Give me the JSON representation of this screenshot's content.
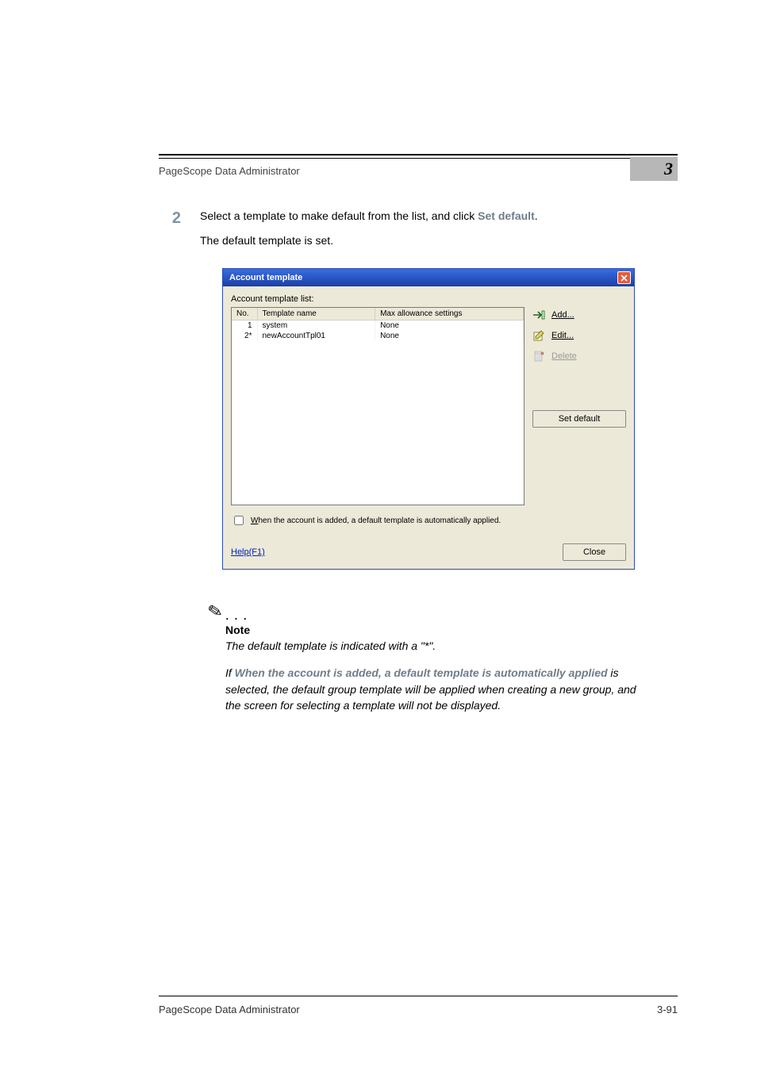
{
  "header": {
    "title": "PageScope Data Administrator",
    "chapter": "3"
  },
  "step": {
    "number": "2",
    "line1_a": "Select a template to make default from the list, and click ",
    "line1_b": "Set default",
    "line1_c": ".",
    "line2": "The default template is set."
  },
  "dialog": {
    "title": "Account template",
    "list_label": "Account template list:",
    "columns": {
      "c0": "No.",
      "c1": "Template name",
      "c2": "Max allowance settings"
    },
    "rows": [
      {
        "no": "1",
        "name": "system",
        "max": "None"
      },
      {
        "no": "2*",
        "name": "newAccountTpl01",
        "max": "None"
      }
    ],
    "buttons": {
      "add": "Add...",
      "edit": "Edit...",
      "delete": "Delete",
      "set_default": "Set default",
      "close": "Close"
    },
    "checkbox_pre": "W",
    "checkbox_label": "hen the account is added, a default template is automatically applied.",
    "help": "Help(F1)"
  },
  "note": {
    "heading": "Note",
    "p1": "The default template is indicated with a \"*\".",
    "p2_a": "If ",
    "p2_b": "When the account is added, a default template is automatically applied",
    "p2_c": " is selected, the default group template will be applied when creating a new group, and the screen for selecting a template will not be displayed."
  },
  "footer": {
    "left": "PageScope Data Administrator",
    "right": "3-91"
  }
}
